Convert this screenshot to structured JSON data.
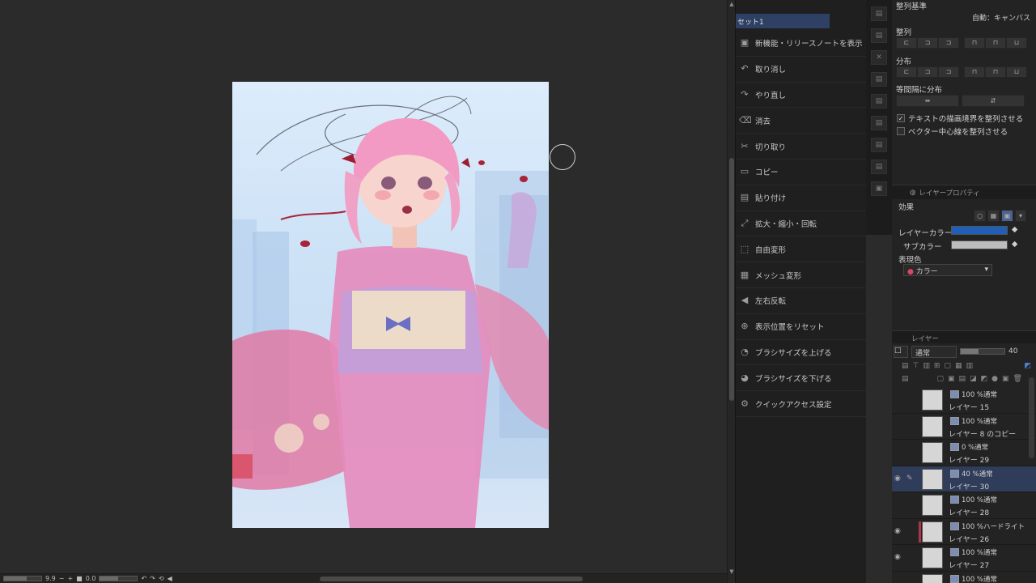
{
  "quick_access": {
    "header": "セット1",
    "items": [
      {
        "label": "新機能・リリースノートを表示",
        "icon": "news-icon"
      },
      {
        "label": "取り消し",
        "icon": "undo-icon"
      },
      {
        "label": "やり直し",
        "icon": "redo-icon"
      },
      {
        "label": "消去",
        "icon": "clear-icon"
      },
      {
        "label": "切り取り",
        "icon": "cut-icon"
      },
      {
        "label": "コピー",
        "icon": "copy-icon"
      },
      {
        "label": "貼り付け",
        "icon": "paste-icon"
      },
      {
        "label": "拡大・縮小・回転",
        "icon": "transform-icon"
      },
      {
        "label": "自由変形",
        "icon": "free-transform-icon"
      },
      {
        "label": "メッシュ変形",
        "icon": "mesh-transform-icon"
      },
      {
        "label": "左右反転",
        "icon": "flip-horizontal-icon"
      },
      {
        "label": "表示位置をリセット",
        "icon": "reset-view-icon"
      },
      {
        "label": "ブラシサイズを上げる",
        "icon": "brush-size-up-icon"
      },
      {
        "label": "ブラシサイズを下げる",
        "icon": "brush-size-down-icon"
      },
      {
        "label": "クイックアクセス設定",
        "icon": "settings-icon"
      }
    ]
  },
  "align": {
    "basis_label": "整列基準",
    "basis_value": "自動：キャンバス",
    "align_label": "整列",
    "distribute_label": "分布",
    "equal_spacing_label": "等間隔に分布",
    "check_text_bounds": "テキストの描画境界を整列させる",
    "check_vector_center": "ベクター中心線を整列させる"
  },
  "layer_property": {
    "tab": "レイヤープロパティ",
    "effect_label": "効果",
    "layer_color_label": "レイヤーカラー",
    "sub_color_label": "サブカラー",
    "expression_label": "表現色",
    "expression_value": "カラー",
    "layer_color": "#1f5fb8",
    "sub_color": "#bdbdbd"
  },
  "layer_panel": {
    "tab": "レイヤー",
    "blend_mode": "通常",
    "opacity": "40",
    "layers": [
      {
        "mode": "100 %通常",
        "name": "レイヤー 15",
        "selected": false,
        "visible": false
      },
      {
        "mode": "100 %通常",
        "name": "レイヤー 8 のコピー",
        "selected": false,
        "visible": false
      },
      {
        "mode": "0 %通常",
        "name": "レイヤー 29",
        "selected": false,
        "visible": false
      },
      {
        "mode": "40 %通常",
        "name": "レイヤー 30",
        "selected": true,
        "visible": true
      },
      {
        "mode": "100 %通常",
        "name": "レイヤー 28",
        "selected": false,
        "visible": false
      },
      {
        "mode": "100 %ハードライト",
        "name": "レイヤー 26",
        "selected": false,
        "visible": true
      },
      {
        "mode": "100 %通常",
        "name": "レイヤー 27",
        "selected": false,
        "visible": true
      },
      {
        "mode": "100 %通常",
        "name": "",
        "selected": false,
        "visible": false
      }
    ]
  },
  "status_bar": {
    "zoom": "9.9",
    "angle": "0.0"
  }
}
